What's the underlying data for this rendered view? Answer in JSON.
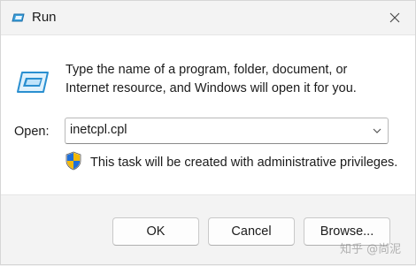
{
  "window": {
    "title": "Run",
    "icon": "run-icon",
    "close_icon": "close-icon"
  },
  "dialog": {
    "description_line1": "Type the name of a program, folder, document, or",
    "description_line2": "Internet resource, and Windows will open it for you.",
    "open_label": "Open:",
    "open_value": "inetcpl.cpl",
    "admin_note": "This task will be created with administrative privileges.",
    "shield_icon": "uac-shield-icon"
  },
  "buttons": {
    "ok": "OK",
    "cancel": "Cancel",
    "browse": "Browse..."
  },
  "watermark": "知乎 @尚泥",
  "colors": {
    "title_bg": "#f3f3f3",
    "content_bg": "#ffffff",
    "accent_blue": "#1e8ce0"
  }
}
